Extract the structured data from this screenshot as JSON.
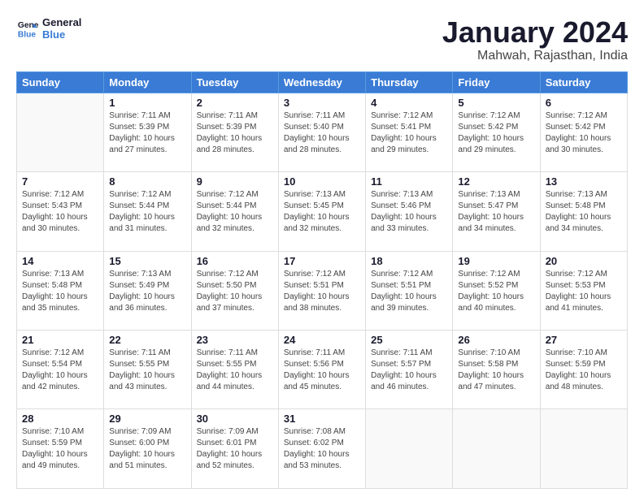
{
  "logo": {
    "line1": "General",
    "line2": "Blue"
  },
  "title": "January 2024",
  "subtitle": "Mahwah, Rajasthan, India",
  "days_header": [
    "Sunday",
    "Monday",
    "Tuesday",
    "Wednesday",
    "Thursday",
    "Friday",
    "Saturday"
  ],
  "weeks": [
    [
      {
        "day": "",
        "info": ""
      },
      {
        "day": "1",
        "info": "Sunrise: 7:11 AM\nSunset: 5:39 PM\nDaylight: 10 hours\nand 27 minutes."
      },
      {
        "day": "2",
        "info": "Sunrise: 7:11 AM\nSunset: 5:39 PM\nDaylight: 10 hours\nand 28 minutes."
      },
      {
        "day": "3",
        "info": "Sunrise: 7:11 AM\nSunset: 5:40 PM\nDaylight: 10 hours\nand 28 minutes."
      },
      {
        "day": "4",
        "info": "Sunrise: 7:12 AM\nSunset: 5:41 PM\nDaylight: 10 hours\nand 29 minutes."
      },
      {
        "day": "5",
        "info": "Sunrise: 7:12 AM\nSunset: 5:42 PM\nDaylight: 10 hours\nand 29 minutes."
      },
      {
        "day": "6",
        "info": "Sunrise: 7:12 AM\nSunset: 5:42 PM\nDaylight: 10 hours\nand 30 minutes."
      }
    ],
    [
      {
        "day": "7",
        "info": "Sunrise: 7:12 AM\nSunset: 5:43 PM\nDaylight: 10 hours\nand 30 minutes."
      },
      {
        "day": "8",
        "info": "Sunrise: 7:12 AM\nSunset: 5:44 PM\nDaylight: 10 hours\nand 31 minutes."
      },
      {
        "day": "9",
        "info": "Sunrise: 7:12 AM\nSunset: 5:44 PM\nDaylight: 10 hours\nand 32 minutes."
      },
      {
        "day": "10",
        "info": "Sunrise: 7:13 AM\nSunset: 5:45 PM\nDaylight: 10 hours\nand 32 minutes."
      },
      {
        "day": "11",
        "info": "Sunrise: 7:13 AM\nSunset: 5:46 PM\nDaylight: 10 hours\nand 33 minutes."
      },
      {
        "day": "12",
        "info": "Sunrise: 7:13 AM\nSunset: 5:47 PM\nDaylight: 10 hours\nand 34 minutes."
      },
      {
        "day": "13",
        "info": "Sunrise: 7:13 AM\nSunset: 5:48 PM\nDaylight: 10 hours\nand 34 minutes."
      }
    ],
    [
      {
        "day": "14",
        "info": "Sunrise: 7:13 AM\nSunset: 5:48 PM\nDaylight: 10 hours\nand 35 minutes."
      },
      {
        "day": "15",
        "info": "Sunrise: 7:13 AM\nSunset: 5:49 PM\nDaylight: 10 hours\nand 36 minutes."
      },
      {
        "day": "16",
        "info": "Sunrise: 7:12 AM\nSunset: 5:50 PM\nDaylight: 10 hours\nand 37 minutes."
      },
      {
        "day": "17",
        "info": "Sunrise: 7:12 AM\nSunset: 5:51 PM\nDaylight: 10 hours\nand 38 minutes."
      },
      {
        "day": "18",
        "info": "Sunrise: 7:12 AM\nSunset: 5:51 PM\nDaylight: 10 hours\nand 39 minutes."
      },
      {
        "day": "19",
        "info": "Sunrise: 7:12 AM\nSunset: 5:52 PM\nDaylight: 10 hours\nand 40 minutes."
      },
      {
        "day": "20",
        "info": "Sunrise: 7:12 AM\nSunset: 5:53 PM\nDaylight: 10 hours\nand 41 minutes."
      }
    ],
    [
      {
        "day": "21",
        "info": "Sunrise: 7:12 AM\nSunset: 5:54 PM\nDaylight: 10 hours\nand 42 minutes."
      },
      {
        "day": "22",
        "info": "Sunrise: 7:11 AM\nSunset: 5:55 PM\nDaylight: 10 hours\nand 43 minutes."
      },
      {
        "day": "23",
        "info": "Sunrise: 7:11 AM\nSunset: 5:55 PM\nDaylight: 10 hours\nand 44 minutes."
      },
      {
        "day": "24",
        "info": "Sunrise: 7:11 AM\nSunset: 5:56 PM\nDaylight: 10 hours\nand 45 minutes."
      },
      {
        "day": "25",
        "info": "Sunrise: 7:11 AM\nSunset: 5:57 PM\nDaylight: 10 hours\nand 46 minutes."
      },
      {
        "day": "26",
        "info": "Sunrise: 7:10 AM\nSunset: 5:58 PM\nDaylight: 10 hours\nand 47 minutes."
      },
      {
        "day": "27",
        "info": "Sunrise: 7:10 AM\nSunset: 5:59 PM\nDaylight: 10 hours\nand 48 minutes."
      }
    ],
    [
      {
        "day": "28",
        "info": "Sunrise: 7:10 AM\nSunset: 5:59 PM\nDaylight: 10 hours\nand 49 minutes."
      },
      {
        "day": "29",
        "info": "Sunrise: 7:09 AM\nSunset: 6:00 PM\nDaylight: 10 hours\nand 51 minutes."
      },
      {
        "day": "30",
        "info": "Sunrise: 7:09 AM\nSunset: 6:01 PM\nDaylight: 10 hours\nand 52 minutes."
      },
      {
        "day": "31",
        "info": "Sunrise: 7:08 AM\nSunset: 6:02 PM\nDaylight: 10 hours\nand 53 minutes."
      },
      {
        "day": "",
        "info": ""
      },
      {
        "day": "",
        "info": ""
      },
      {
        "day": "",
        "info": ""
      }
    ]
  ]
}
